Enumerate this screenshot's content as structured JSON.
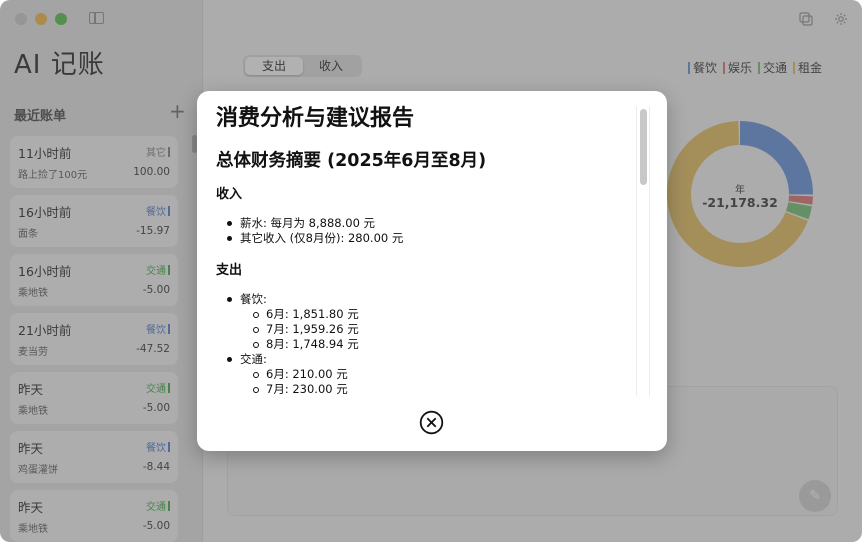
{
  "app": {
    "title": "AI 记账"
  },
  "sidebar": {
    "section_label": "最近账单",
    "add_label": "+",
    "bills": [
      {
        "time": "11小时前",
        "desc": "路上捡了100元",
        "category": "其它",
        "amount": "100.00",
        "tag_color": "#888888"
      },
      {
        "time": "16小时前",
        "desc": "面条",
        "category": "餐饮",
        "amount": "-15.97",
        "tag_color": "#5b86d6"
      },
      {
        "time": "16小时前",
        "desc": "乘地铁",
        "category": "交通",
        "amount": "-5.00",
        "tag_color": "#4caf50"
      },
      {
        "time": "21小时前",
        "desc": "麦当劳",
        "category": "餐饮",
        "amount": "-47.52",
        "tag_color": "#5b86d6"
      },
      {
        "time": "昨天",
        "desc": "乘地铁",
        "category": "交通",
        "amount": "-5.00",
        "tag_color": "#4caf50"
      },
      {
        "time": "昨天",
        "desc": "鸡蛋灌饼",
        "category": "餐饮",
        "amount": "-8.44",
        "tag_color": "#5b86d6"
      },
      {
        "time": "昨天",
        "desc": "乘地铁",
        "category": "交通",
        "amount": "-5.00",
        "tag_color": "#4caf50"
      }
    ]
  },
  "main": {
    "segment": {
      "expense": "支出",
      "income": "收入"
    },
    "legend": [
      {
        "label": "餐饮",
        "color": "#6f9ae0"
      },
      {
        "label": "娱乐",
        "color": "#e07a7a"
      },
      {
        "label": "交通",
        "color": "#7cc77c"
      },
      {
        "label": "租金",
        "color": "#e8c46c"
      }
    ],
    "donut": {
      "period": "年",
      "total": "-21,178.32",
      "slices": [
        {
          "name": "餐饮",
          "fraction": 0.255,
          "color": "#6f9ae0"
        },
        {
          "name": "娱乐",
          "fraction": 0.022,
          "color": "#e07a7a"
        },
        {
          "name": "交通",
          "fraction": 0.033,
          "color": "#7cc77c"
        },
        {
          "name": "租金",
          "fraction": 0.69,
          "color": "#e8c46c"
        }
      ]
    }
  },
  "report": {
    "title": "消费分析与建议报告",
    "summary_heading": "总体财务摘要 (2025年6月至8月)",
    "income_heading": "收入",
    "income_items": [
      "薪水: 每月为 8,888.00 元",
      "其它收入 (仅8月份): 280.00 元"
    ],
    "expense_heading": "支出",
    "expense_groups": [
      {
        "label": "餐饮:",
        "items": [
          "6月: 1,851.80 元",
          "7月: 1,959.26 元",
          "8月: 1,748.94 元"
        ]
      },
      {
        "label": "交通:",
        "items": [
          "6月: 210.00 元",
          "7月: 230.00 元"
        ]
      }
    ]
  }
}
